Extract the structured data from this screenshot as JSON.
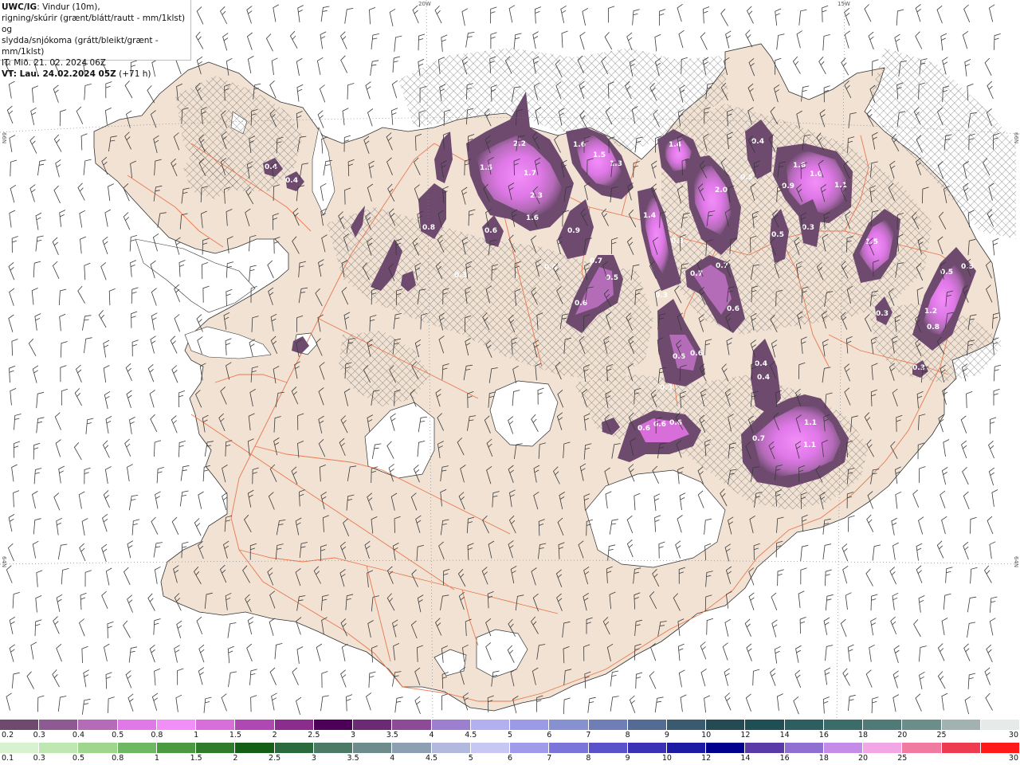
{
  "header": {
    "title_bold": "UWC/IG",
    "title_rest": ": Vindur (10m),",
    "line2": "rigning/skúrir (grænt/blátt/rautt - mm/1klst) og",
    "line3": "slydda/snjókoma (grátt/bleikt/grænt - mm/1klst)",
    "line4": "IT: Mið. 21. 02. 2024 06Z",
    "line5_bold": "VT: Lau. 24.02.2024 05Z",
    "line5_rest": " (+71 h)"
  },
  "grid_labels": {
    "lon_20w": "20W",
    "lon_15w": "15W",
    "lat_66n_left": "66N",
    "lat_66n_right": "66N",
    "lat_64n_left": "64N",
    "lat_64n_right": "64N"
  },
  "colors": {
    "land": "#f1e2d3",
    "roads": "#e8744a",
    "sea": "#ffffff",
    "glacier": "#ffffff",
    "barbs": "#3a3a3a",
    "hatch": "#6d6d6d"
  },
  "precip_labels": [
    "1.5",
    "2.2",
    "1.7",
    "2.3",
    "1.6",
    "1.6",
    "1.5",
    "1.3",
    "1.4",
    "2.0",
    "1.4",
    "1.6",
    "1.0",
    "0.9",
    "1.1",
    "1.5",
    "0.4",
    "0.5",
    "0.3",
    "0.6",
    "0.9",
    "0.7",
    "0.5",
    "0.6",
    "0.4",
    "0.8",
    "0.3",
    "0.7",
    "0.6",
    "0.7",
    "0.6",
    "0.3",
    "0.6",
    "0.6",
    "0.3",
    "0.4",
    "0.4",
    "0.3",
    "1.2",
    "0.8",
    "0.5",
    "0.3",
    "0.7",
    "1.1",
    "1.1",
    "0.5",
    "0.5",
    "0.6",
    "0.6",
    "0.3",
    "0.4",
    "0.4"
  ],
  "legend_snow": {
    "labels": [
      "0.2",
      "0.3",
      "0.4",
      "0.5",
      "0.8",
      "1",
      "1.5",
      "2",
      "2.5",
      "3",
      "3.5",
      "4",
      "4.5",
      "5",
      "6",
      "7",
      "8",
      "9",
      "10",
      "12",
      "14",
      "16",
      "18",
      "20",
      "25",
      "30"
    ],
    "colors": [
      "#6d4a6e",
      "#8e5a92",
      "#b46bb8",
      "#e078e8",
      "#f28ef8",
      "#d76ed9",
      "#b048b3",
      "#8a2d8c",
      "#4d0057",
      "#6b2a73",
      "#8c4a97",
      "#9c7fcf",
      "#b3b0f0",
      "#9a9ae6",
      "#8790d0",
      "#6f7fb6",
      "#546c94",
      "#3a5a70",
      "#244a52",
      "#1f4f55",
      "#2e5e60",
      "#3c6c6a",
      "#4f7a78",
      "#6b8e8a",
      "#a2b2b0",
      "#e6ebea"
    ]
  },
  "legend_rain": {
    "labels": [
      "0.1",
      "0.3",
      "0.5",
      "0.8",
      "1",
      "1.5",
      "2",
      "2.5",
      "3",
      "3.5",
      "4",
      "4.5",
      "5",
      "6",
      "7",
      "8",
      "9",
      "10",
      "12",
      "14",
      "16",
      "18",
      "20",
      "25",
      "30"
    ],
    "colors": [
      "#d8f2cf",
      "#bfe7b2",
      "#9fd68e",
      "#6fb863",
      "#4b9a42",
      "#2f7d2c",
      "#155e16",
      "#2a6a3c",
      "#4b7a66",
      "#6e8c8b",
      "#8d9fb2",
      "#b3b8de",
      "#c8c6f2",
      "#9f9ae9",
      "#7b75d9",
      "#5a52c8",
      "#3b31b5",
      "#1d1aa3",
      "#00008f",
      "#5a3aa6",
      "#8f6fcf",
      "#c48ce6",
      "#f2a6e6",
      "#f07aa0",
      "#ef3b4f",
      "#ff1a1a"
    ]
  }
}
